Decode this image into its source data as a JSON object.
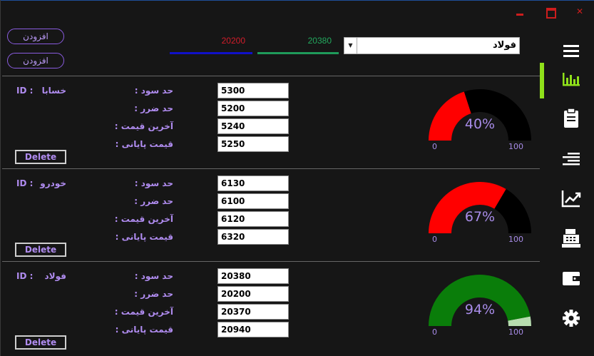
{
  "window": {
    "close_glyph": "✕"
  },
  "toolbar": {
    "add_button_1": "افزودن",
    "add_button_2": "افزودن",
    "price_red": "20200",
    "price_green": "20380",
    "symbol_selected": "فولاد",
    "colors": {
      "red": "#d21d2a",
      "green": "#23a85e",
      "blue_line": "#1010c8"
    }
  },
  "labels": {
    "id": "ID :",
    "profit_limit": ": حد سود",
    "loss_limit": ": حد ضرر",
    "last_price": ": آخرین قیمت",
    "final_price": ": قیمت پایانی",
    "delete": "Delete",
    "gauge_min": "0",
    "gauge_max": "100"
  },
  "panels": [
    {
      "name": "خسابا",
      "profit": "5300",
      "loss": "5200",
      "last": "5240",
      "final": "5250",
      "percent": 40,
      "percent_label": "40%",
      "color": "#ff0000"
    },
    {
      "name": "خودرو",
      "profit": "6130",
      "loss": "6100",
      "last": "6120",
      "final": "6320",
      "percent": 67,
      "percent_label": "67%",
      "color": "#ff0000"
    },
    {
      "name": "فولاد",
      "profit": "20380",
      "loss": "20200",
      "last": "20370",
      "final": "20940",
      "percent": 94,
      "percent_label": "94%",
      "color": "#0a7d0a"
    }
  ],
  "sidebar": {
    "items": [
      "menu-icon",
      "bar-chart-icon",
      "clipboard-icon",
      "list-icon",
      "trend-chart-icon",
      "cash-register-icon",
      "wallet-icon",
      "gear-icon"
    ],
    "selected_index": 1,
    "accent": "#8fe01a"
  }
}
